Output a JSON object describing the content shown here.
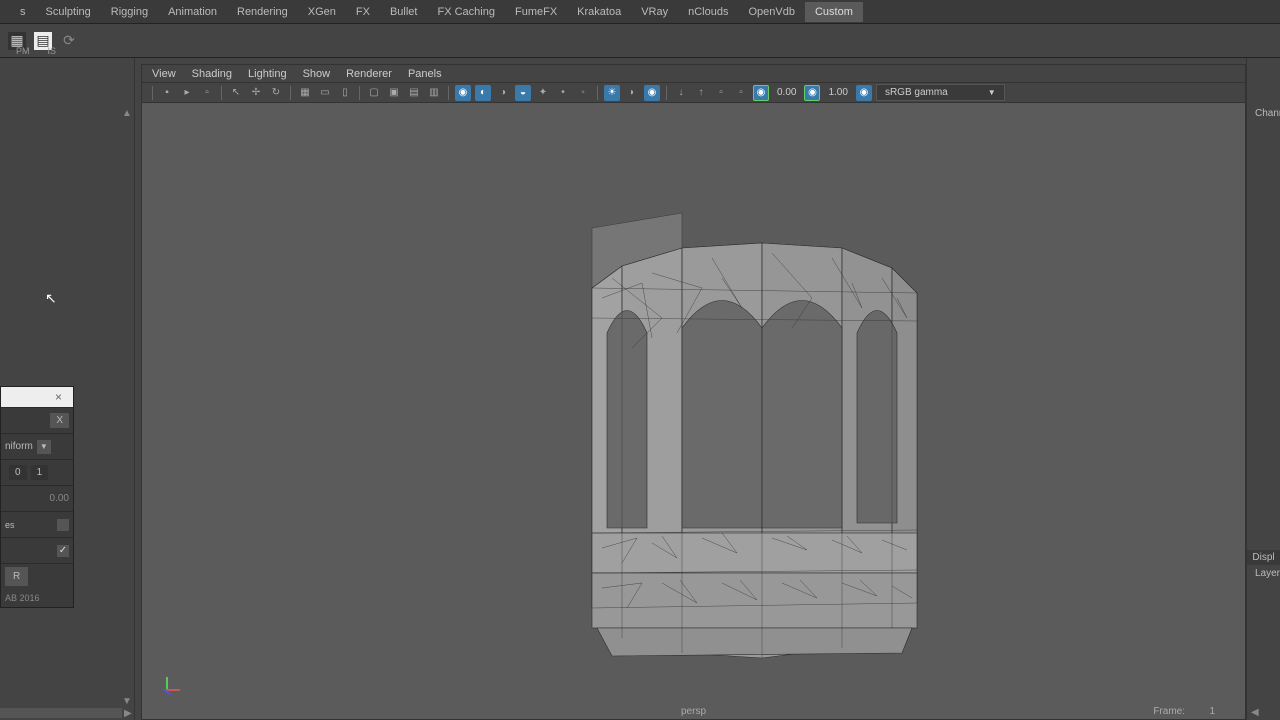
{
  "top_tabs": {
    "items": [
      "s",
      "Sculpting",
      "Rigging",
      "Animation",
      "Rendering",
      "XGen",
      "FX",
      "Bullet",
      "FX Caching",
      "FumeFX",
      "Krakatoa",
      "VRay",
      "nClouds",
      "OpenVdb",
      "Custom"
    ],
    "active_index": 14
  },
  "shelf": {
    "sub_labels": [
      "PM",
      "IS"
    ]
  },
  "viewport": {
    "menus": [
      "View",
      "Shading",
      "Lighting",
      "Show",
      "Renderer",
      "Panels"
    ],
    "val1": "0.00",
    "val2": "1.00",
    "colorspace": "sRGB gamma",
    "camera": "persp",
    "frame_label": "Frame:",
    "frame_value": "1"
  },
  "floating_panel": {
    "x_label": "X",
    "mode": "niform",
    "num_a": "0",
    "num_b": "1",
    "val_zero": "0.00",
    "check_on": "✓",
    "btn": "R",
    "footer": "AB 2016"
  },
  "right_panel": {
    "channel": "Chann",
    "display": "Displ",
    "layers": "Layer"
  }
}
